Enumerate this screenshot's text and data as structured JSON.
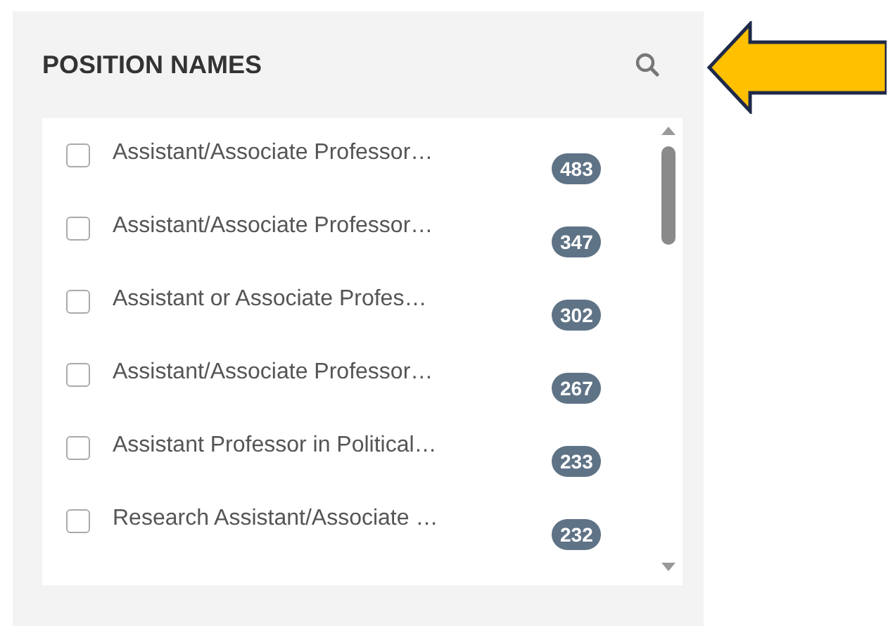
{
  "panel": {
    "title": "POSITION NAMES"
  },
  "items": [
    {
      "label": "Assistant/Associate Professor…",
      "count": "483",
      "checked": false
    },
    {
      "label": "Assistant/Associate Professor…",
      "count": "347",
      "checked": false
    },
    {
      "label": "Assistant or Associate Profes…",
      "count": "302",
      "checked": false
    },
    {
      "label": "Assistant/Associate Professor…",
      "count": "267",
      "checked": false
    },
    {
      "label": "Assistant Professor in Political…",
      "count": "233",
      "checked": false
    },
    {
      "label": "Research Assistant/Associate …",
      "count": "232",
      "checked": false
    }
  ]
}
